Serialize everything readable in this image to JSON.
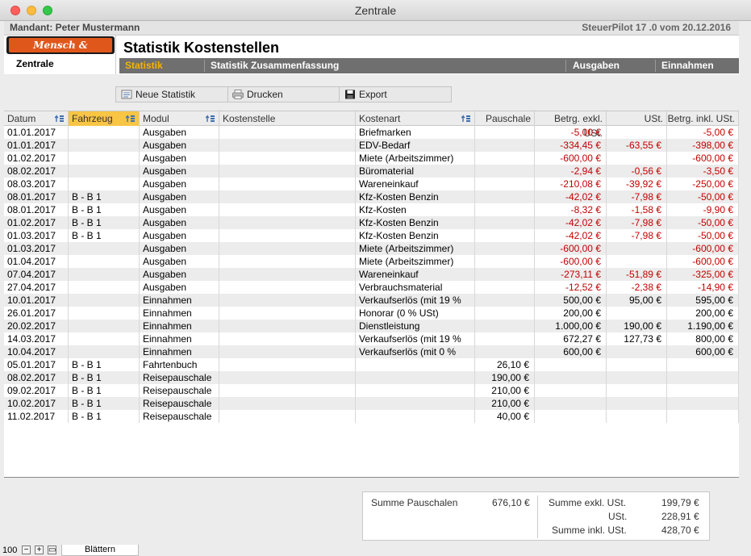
{
  "window": {
    "title": "Zentrale"
  },
  "mandant": {
    "label": "Mandant: Peter Mustermann",
    "version": "SteuerPilot 17 .0 vom 20.12.2016"
  },
  "logo": {
    "text": "Mensch & Software"
  },
  "nav": {
    "zentrale": "Zentrale"
  },
  "page": {
    "title": "Statistik Kostenstellen"
  },
  "tabs": {
    "statistik": "Statistik",
    "zusammenfassung": "Statistik Zusammenfassung",
    "ausgaben": "Ausgaben",
    "einnahmen": "Einnahmen"
  },
  "toolbar": {
    "neue_statistik": "Neue Statistik",
    "drucken": "Drucken",
    "export": "Export"
  },
  "colors": {
    "accent": "#f4b400",
    "tabbar": "#6f6f6f",
    "negative": "#c30000",
    "sorted_header": "#f8c544"
  },
  "table": {
    "headers": {
      "datum": "Datum",
      "fahrzeug": "Fahrzeug",
      "modul": "Modul",
      "kostenstelle": "Kostenstelle",
      "kostenart": "Kostenart",
      "pauschale": "Pauschale",
      "exkl": "Betrg. exkl. USt.",
      "ust": "USt.",
      "inkl": "Betrg. inkl. USt."
    },
    "rows": [
      {
        "datum": "01.01.2017",
        "fahrzeug": "",
        "modul": "Ausgaben",
        "kostenstelle": "",
        "kostenart": "Briefmarken",
        "pauschale": "",
        "exkl": "-5,00 €",
        "ust": "",
        "inkl": "-5,00 €"
      },
      {
        "datum": "01.01.2017",
        "fahrzeug": "",
        "modul": "Ausgaben",
        "kostenstelle": "",
        "kostenart": "EDV-Bedarf",
        "pauschale": "",
        "exkl": "-334,45 €",
        "ust": "-63,55 €",
        "inkl": "-398,00 €"
      },
      {
        "datum": "01.02.2017",
        "fahrzeug": "",
        "modul": "Ausgaben",
        "kostenstelle": "",
        "kostenart": "Miete (Arbeitszimmer)",
        "pauschale": "",
        "exkl": "-600,00 €",
        "ust": "",
        "inkl": "-600,00 €"
      },
      {
        "datum": "08.02.2017",
        "fahrzeug": "",
        "modul": "Ausgaben",
        "kostenstelle": "",
        "kostenart": "Büromaterial",
        "pauschale": "",
        "exkl": "-2,94 €",
        "ust": "-0,56 €",
        "inkl": "-3,50 €"
      },
      {
        "datum": "08.03.2017",
        "fahrzeug": "",
        "modul": "Ausgaben",
        "kostenstelle": "",
        "kostenart": "Wareneinkauf",
        "pauschale": "",
        "exkl": "-210,08 €",
        "ust": "-39,92 €",
        "inkl": "-250,00 €"
      },
      {
        "datum": "08.01.2017",
        "fahrzeug": "B - B 1",
        "modul": "Ausgaben",
        "kostenstelle": "",
        "kostenart": "Kfz-Kosten Benzin",
        "pauschale": "",
        "exkl": "-42,02 €",
        "ust": "-7,98 €",
        "inkl": "-50,00 €"
      },
      {
        "datum": "08.01.2017",
        "fahrzeug": "B - B 1",
        "modul": "Ausgaben",
        "kostenstelle": "",
        "kostenart": "Kfz-Kosten",
        "pauschale": "",
        "exkl": "-8,32 €",
        "ust": "-1,58 €",
        "inkl": "-9,90 €"
      },
      {
        "datum": "01.02.2017",
        "fahrzeug": "B - B 1",
        "modul": "Ausgaben",
        "kostenstelle": "",
        "kostenart": "Kfz-Kosten Benzin",
        "pauschale": "",
        "exkl": "-42,02 €",
        "ust": "-7,98 €",
        "inkl": "-50,00 €"
      },
      {
        "datum": "01.03.2017",
        "fahrzeug": "B - B 1",
        "modul": "Ausgaben",
        "kostenstelle": "",
        "kostenart": "Kfz-Kosten Benzin",
        "pauschale": "",
        "exkl": "-42,02 €",
        "ust": "-7,98 €",
        "inkl": "-50,00 €"
      },
      {
        "datum": "01.03.2017",
        "fahrzeug": "",
        "modul": "Ausgaben",
        "kostenstelle": "",
        "kostenart": "Miete (Arbeitszimmer)",
        "pauschale": "",
        "exkl": "-600,00 €",
        "ust": "",
        "inkl": "-600,00 €"
      },
      {
        "datum": "01.04.2017",
        "fahrzeug": "",
        "modul": "Ausgaben",
        "kostenstelle": "",
        "kostenart": "Miete (Arbeitszimmer)",
        "pauschale": "",
        "exkl": "-600,00 €",
        "ust": "",
        "inkl": "-600,00 €"
      },
      {
        "datum": "07.04.2017",
        "fahrzeug": "",
        "modul": "Ausgaben",
        "kostenstelle": "",
        "kostenart": "Wareneinkauf",
        "pauschale": "",
        "exkl": "-273,11 €",
        "ust": "-51,89 €",
        "inkl": "-325,00 €"
      },
      {
        "datum": "27.04.2017",
        "fahrzeug": "",
        "modul": "Ausgaben",
        "kostenstelle": "",
        "kostenart": "Verbrauchsmaterial",
        "pauschale": "",
        "exkl": "-12,52 €",
        "ust": "-2,38 €",
        "inkl": "-14,90 €"
      },
      {
        "datum": "10.01.2017",
        "fahrzeug": "",
        "modul": "Einnahmen",
        "kostenstelle": "",
        "kostenart": "Verkaufserlös (mit 19 %",
        "pauschale": "",
        "exkl": "500,00 €",
        "ust": "95,00 €",
        "inkl": "595,00 €"
      },
      {
        "datum": "26.01.2017",
        "fahrzeug": "",
        "modul": "Einnahmen",
        "kostenstelle": "",
        "kostenart": "Honorar (0 % USt)",
        "pauschale": "",
        "exkl": "200,00 €",
        "ust": "",
        "inkl": "200,00 €"
      },
      {
        "datum": "20.02.2017",
        "fahrzeug": "",
        "modul": "Einnahmen",
        "kostenstelle": "",
        "kostenart": "Dienstleistung",
        "pauschale": "",
        "exkl": "1.000,00 €",
        "ust": "190,00 €",
        "inkl": "1.190,00 €"
      },
      {
        "datum": "14.03.2017",
        "fahrzeug": "",
        "modul": "Einnahmen",
        "kostenstelle": "",
        "kostenart": "Verkaufserlös (mit 19 %",
        "pauschale": "",
        "exkl": "672,27 €",
        "ust": "127,73 €",
        "inkl": "800,00 €"
      },
      {
        "datum": "10.04.2017",
        "fahrzeug": "",
        "modul": "Einnahmen",
        "kostenstelle": "",
        "kostenart": "Verkaufserlös (mit 0 %",
        "pauschale": "",
        "exkl": "600,00 €",
        "ust": "",
        "inkl": "600,00 €"
      },
      {
        "datum": "05.01.2017",
        "fahrzeug": "B - B 1",
        "modul": "Fahrtenbuch",
        "kostenstelle": "",
        "kostenart": "",
        "pauschale": "26,10 €",
        "exkl": "",
        "ust": "",
        "inkl": ""
      },
      {
        "datum": "08.02.2017",
        "fahrzeug": "B - B 1",
        "modul": "Reisepauschale",
        "kostenstelle": "",
        "kostenart": "",
        "pauschale": "190,00 €",
        "exkl": "",
        "ust": "",
        "inkl": ""
      },
      {
        "datum": "09.02.2017",
        "fahrzeug": "B - B 1",
        "modul": "Reisepauschale",
        "kostenstelle": "",
        "kostenart": "",
        "pauschale": "210,00 €",
        "exkl": "",
        "ust": "",
        "inkl": ""
      },
      {
        "datum": "10.02.2017",
        "fahrzeug": "B - B 1",
        "modul": "Reisepauschale",
        "kostenstelle": "",
        "kostenart": "",
        "pauschale": "210,00 €",
        "exkl": "",
        "ust": "",
        "inkl": ""
      },
      {
        "datum": "11.02.2017",
        "fahrzeug": "B - B 1",
        "modul": "Reisepauschale",
        "kostenstelle": "",
        "kostenart": "",
        "pauschale": "40,00 €",
        "exkl": "",
        "ust": "",
        "inkl": ""
      }
    ]
  },
  "summary": {
    "pauschalen_label": "Summe Pauschalen",
    "pauschalen_value": "676,10 €",
    "exkl_label": "Summe exkl. USt.",
    "exkl_value": "199,79 €",
    "ust_label": "USt.",
    "ust_value": "228,91 €",
    "inkl_label": "Summe inkl. USt.",
    "inkl_value": "428,70 €"
  },
  "statusbar": {
    "zoom": "100",
    "mode_tab": "Blättern"
  }
}
